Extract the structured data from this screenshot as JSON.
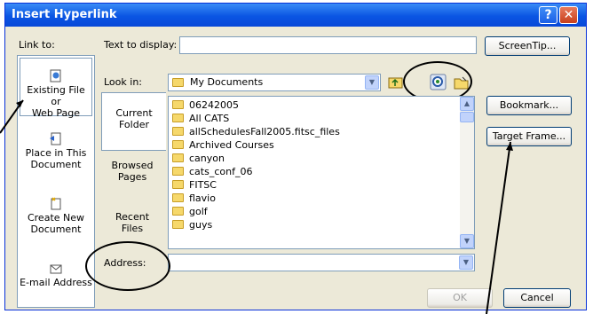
{
  "window": {
    "title": "Insert Hyperlink",
    "help_glyph": "?",
    "close_glyph": "✕"
  },
  "link_to": {
    "label": "Link to:",
    "items": [
      {
        "label_line1": "Existing File or",
        "label_line2": "Web Page",
        "icon": "web-page-icon",
        "selected": true
      },
      {
        "label_line1": "Place in This",
        "label_line2": "Document",
        "icon": "document-place-icon",
        "selected": false
      },
      {
        "label_line1": "Create New",
        "label_line2": "Document",
        "icon": "new-document-icon",
        "selected": false
      },
      {
        "label_line1": "E-mail Address",
        "label_line2": "",
        "icon": "email-icon",
        "selected": false
      }
    ]
  },
  "text_to_display": {
    "label": "Text to display:",
    "value": ""
  },
  "screentip_button": "ScreenTip...",
  "look_in": {
    "label": "Look in:",
    "value": "My Documents"
  },
  "tabs": [
    {
      "label_line1": "Current",
      "label_line2": "Folder",
      "selected": true
    },
    {
      "label_line1": "Browsed",
      "label_line2": "Pages",
      "selected": false
    },
    {
      "label_line1": "Recent",
      "label_line2": "Files",
      "selected": false
    }
  ],
  "files": [
    "06242005",
    "All CATS",
    "allSchedulesFall2005.fitsc_files",
    "Archived Courses",
    "canyon",
    "cats_conf_06",
    "FITSC",
    "flavio",
    "golf",
    "guys"
  ],
  "bookmark_button": "Bookmark...",
  "target_frame_button": "Target Frame...",
  "address": {
    "label": "Address:",
    "value": ""
  },
  "ok_button": "OK",
  "cancel_button": "Cancel",
  "colors": {
    "titlebar": "#0a55e3",
    "dialog_bg": "#ece9d8",
    "field_border": "#7f9db9"
  }
}
